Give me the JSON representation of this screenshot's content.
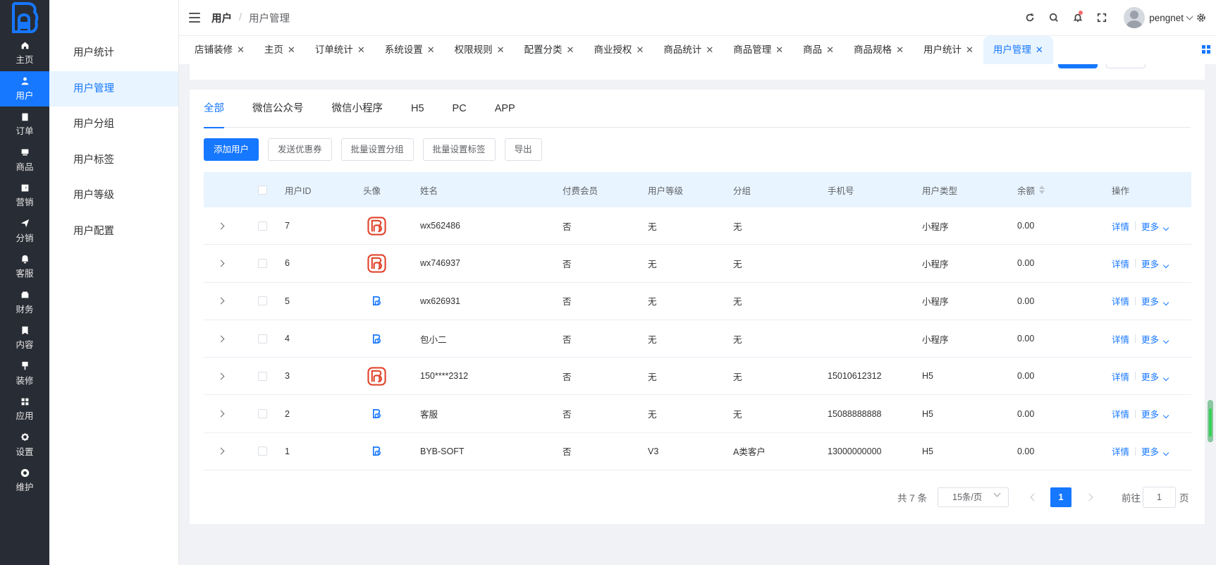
{
  "rail": {
    "items": [
      {
        "label": "主页",
        "icon": "home-icon"
      },
      {
        "label": "用户",
        "icon": "user-icon",
        "active": true
      },
      {
        "label": "订单",
        "icon": "order-icon"
      },
      {
        "label": "商品",
        "icon": "goods-icon"
      },
      {
        "label": "营销",
        "icon": "marketing-icon"
      },
      {
        "label": "分销",
        "icon": "distribution-icon"
      },
      {
        "label": "客服",
        "icon": "service-icon"
      },
      {
        "label": "财务",
        "icon": "finance-icon"
      },
      {
        "label": "内容",
        "icon": "content-icon"
      },
      {
        "label": "装修",
        "icon": "decorate-icon"
      },
      {
        "label": "应用",
        "icon": "apps-icon"
      },
      {
        "label": "设置",
        "icon": "settings-icon"
      },
      {
        "label": "维护",
        "icon": "maintain-icon"
      }
    ]
  },
  "submenu": {
    "items": [
      "用户统计",
      "用户管理",
      "用户分组",
      "用户标签",
      "用户等级",
      "用户配置"
    ],
    "active_index": 1
  },
  "header": {
    "breadcrumb": [
      "用户",
      "用户管理"
    ],
    "username": "pengnet"
  },
  "tags": [
    "店铺装修",
    "主页",
    "订单统计",
    "系统设置",
    "权限规则",
    "配置分类",
    "商业授权",
    "商品统计",
    "商品管理",
    "商品",
    "商品规格",
    "用户统计",
    "用户管理"
  ],
  "main": {
    "tabs": [
      "全部",
      "微信公众号",
      "微信小程序",
      "H5",
      "PC",
      "APP"
    ],
    "actions": {
      "add_user": "添加用户",
      "send_coupon": "发送优惠券",
      "batch_group": "批量设置分组",
      "batch_tag": "批量设置标签",
      "export": "导出"
    },
    "columns": {
      "id": "用户ID",
      "avatar": "头像",
      "name": "姓名",
      "vip": "付费会员",
      "level": "用户等级",
      "group": "分组",
      "phone": "手机号",
      "type": "用户类型",
      "balance": "余额",
      "ops": "操作"
    },
    "rows": [
      {
        "id": "7",
        "avatar": "big",
        "name": "wx562486",
        "vip": "否",
        "level": "无",
        "group": "无",
        "phone": "",
        "type": "小程序",
        "balance": "0.00"
      },
      {
        "id": "6",
        "avatar": "big",
        "name": "wx746937",
        "vip": "否",
        "level": "无",
        "group": "无",
        "phone": "",
        "type": "小程序",
        "balance": "0.00"
      },
      {
        "id": "5",
        "avatar": "small",
        "name": "wx626931",
        "vip": "否",
        "level": "无",
        "group": "无",
        "phone": "",
        "type": "小程序",
        "balance": "0.00"
      },
      {
        "id": "4",
        "avatar": "small",
        "name": "包小二",
        "vip": "否",
        "level": "无",
        "group": "无",
        "phone": "",
        "type": "小程序",
        "balance": "0.00"
      },
      {
        "id": "3",
        "avatar": "big",
        "name": "150****2312",
        "vip": "否",
        "level": "无",
        "group": "无",
        "phone": "15010612312",
        "type": "H5",
        "balance": "0.00"
      },
      {
        "id": "2",
        "avatar": "small",
        "name": "客服",
        "vip": "否",
        "level": "无",
        "group": "无",
        "phone": "15088888888",
        "type": "H5",
        "balance": "0.00"
      },
      {
        "id": "1",
        "avatar": "small",
        "name": "BYB-SOFT",
        "vip": "否",
        "level": "V3",
        "group": "A类客户",
        "phone": "13000000000",
        "type": "H5",
        "balance": "0.00"
      }
    ],
    "ops": {
      "detail": "详情",
      "more": "更多"
    },
    "pagination": {
      "total": "共 7 条",
      "page_size": "15条/页",
      "current": "1",
      "goto_label": "前往",
      "goto_value": "1",
      "page_unit": "页"
    }
  },
  "colors": {
    "primary": "#1677ff",
    "rail_bg": "#282c34",
    "avatar_red": "#e0452c"
  }
}
